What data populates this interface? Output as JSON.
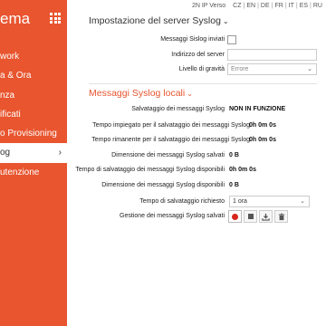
{
  "sidebar": {
    "title": "ema",
    "items": [
      {
        "label": "work",
        "active": false
      },
      {
        "label": "a & Ora",
        "active": false
      },
      {
        "label": "nza",
        "active": false
      },
      {
        "label": "ificati",
        "active": false
      },
      {
        "label": "o Provisioning",
        "active": false
      },
      {
        "label": "og",
        "active": true
      },
      {
        "label": "utenzione",
        "active": false
      }
    ],
    "chevron": "›"
  },
  "topbar": {
    "device": "2N IP Verso",
    "languages": [
      "CZ",
      "EN",
      "DE",
      "FR",
      "IT",
      "ES",
      "RU"
    ]
  },
  "syslog_server": {
    "title": "Impostazione del server Syslog",
    "send_label": "Messaggi Sislog inviati",
    "address_label": "Indirizzo del server",
    "address_value": "",
    "level_label": "Livello di gravità",
    "level_value": "Errore"
  },
  "local_messages": {
    "title": "Messaggi Syslog locali",
    "rows": [
      {
        "label": "Salvataggio dei messaggi Syslog",
        "value": "NON IN FUNZIONE"
      },
      {
        "label": "Tempo impiegato per il salvataggio dei messaggi Syslog",
        "value": "0h 0m 0s"
      },
      {
        "label": "Tempo rimanente per il salvataggio dei messaggi Syslog",
        "value": "0h 0m 0s"
      },
      {
        "label": "Dimensione dei messaggi Syslog salvati",
        "value": "0 B"
      },
      {
        "label": "Tempo di salvataggio dei messaggi Syslog disponibili",
        "value": "0h 0m 0s"
      },
      {
        "label": "Dimensione dei messaggi Syslog disponibili",
        "value": "0 B"
      }
    ],
    "time_label": "Tempo di salvataggio richiesto",
    "time_value": "1 ora",
    "manage_label": "Gestione dei messaggi Syslog salvati"
  },
  "icons": {
    "record": "record-icon",
    "stop": "stop-icon",
    "download": "download-icon",
    "delete": "trash-icon"
  },
  "colors": {
    "accent": "#e8552f",
    "record": "#d7261e"
  }
}
